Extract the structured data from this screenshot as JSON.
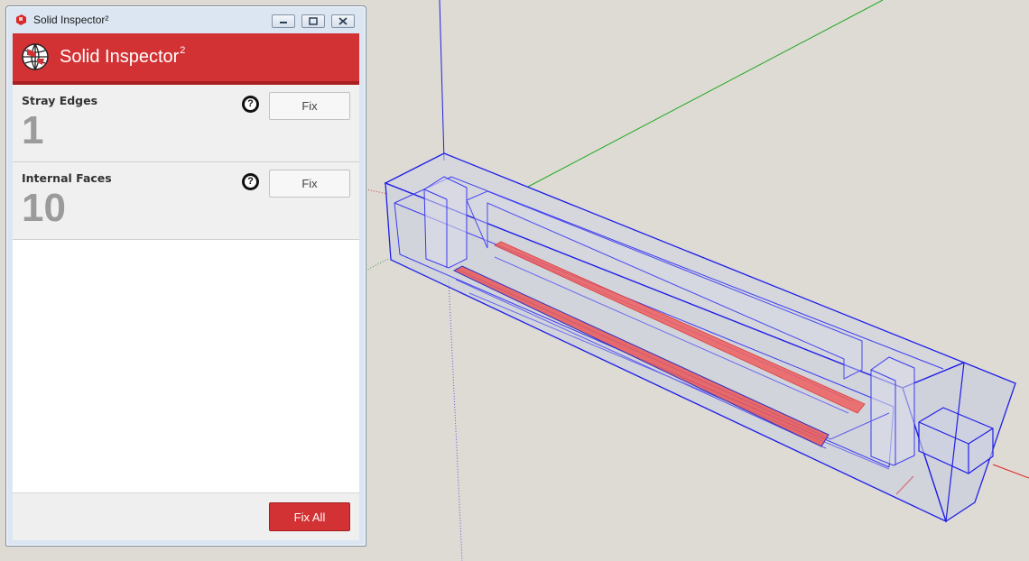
{
  "window": {
    "title": "Solid Inspector²"
  },
  "header": {
    "title": "Solid Inspector",
    "title_sup": "2"
  },
  "checks": [
    {
      "label": "Stray Edges",
      "count": "1",
      "fix_label": "Fix"
    },
    {
      "label": "Internal Faces",
      "count": "10",
      "fix_label": "Fix"
    }
  ],
  "footer": {
    "fix_all_label": "Fix All"
  },
  "colors": {
    "accent": "#d23234",
    "accent_dark": "#a81f22",
    "viewport_bg": "#dedbd5",
    "selection_blue": "#1f1fe6",
    "axis_green": "#22b022",
    "axis_red": "#e02020",
    "highlight_red": "#ef5f5f"
  },
  "icons": {
    "app": "sketchup-icon",
    "logo": "globe-icon",
    "help": "question-icon"
  }
}
